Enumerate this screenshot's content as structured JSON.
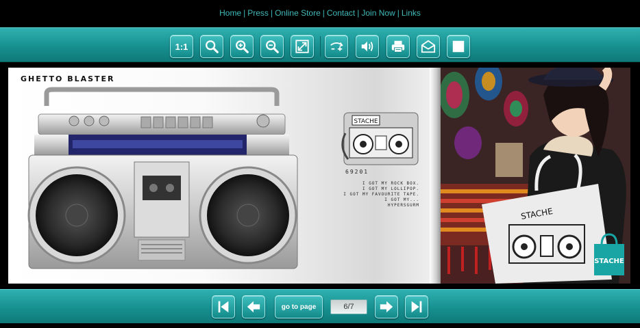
{
  "nav": {
    "links": [
      "Home",
      "Press",
      "Online Store",
      "Contact",
      "Join Now",
      "Links"
    ],
    "separator": "|"
  },
  "toolbar": {
    "actual_size_label": "1:1",
    "icons": [
      "actual-size-icon",
      "magnifier-icon",
      "zoom-in-icon",
      "zoom-out-icon",
      "fit-screen-icon",
      "flip-mode-icon",
      "sound-icon",
      "print-icon",
      "email-icon",
      "fullscreen-icon"
    ]
  },
  "book": {
    "left_title": "GHETTO BLASTER",
    "sku": "69201",
    "lyrics": [
      "I GOT MY ROCK BOX.",
      "I GOT MY LOLLIPOP.",
      "I GOT MY FAVOURITE TAPE.",
      "I GOT MY...",
      "HYPERSGURM"
    ],
    "logo_text": "STACHE"
  },
  "pager": {
    "goto_label": "go to page",
    "current_page": "6/7",
    "icons": [
      "first-page-icon",
      "previous-page-icon",
      "next-page-icon",
      "last-page-icon"
    ]
  },
  "colors": {
    "toolbar_teal": "#179090",
    "nav_link": "#3fb8b8",
    "background": "#000000"
  }
}
